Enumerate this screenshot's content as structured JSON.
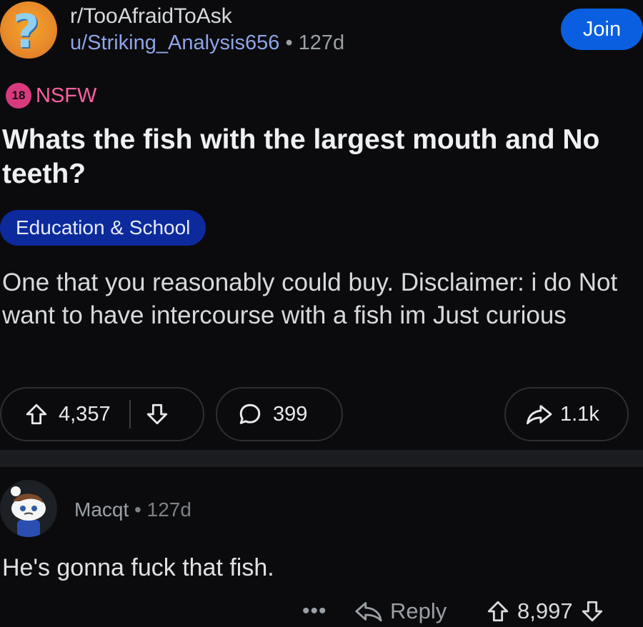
{
  "post": {
    "subreddit": "r/TooAfraidToAsk",
    "author": "u/Striking_Analysis656",
    "separator": "•",
    "age": "127d",
    "join_label": "Join",
    "nsfw_badge": "18",
    "nsfw_label": "NSFW",
    "title": "Whats the fish with the largest mouth and No teeth?",
    "flair": "Education & School",
    "body": "One that you reasonably could buy. Disclaimer: i do Not want to have intercourse with a fish im Just curious",
    "upvotes": "4,357",
    "comments": "399",
    "shares": "1.1k"
  },
  "comment": {
    "author": "Macqt",
    "separator": "•",
    "age": "127d",
    "text": "He's gonna fuck that fish.",
    "more_label": "•••",
    "reply_label": "Reply",
    "score": "8,997"
  },
  "colors": {
    "background": "#0b0b0d",
    "join_button": "#0a5fe0",
    "nsfw": "#ff5fa2",
    "flair_bg": "#0d2a9c",
    "author_link": "#8fa3e8"
  },
  "icons": [
    "question-mark-avatar-icon",
    "upvote-icon",
    "downvote-icon",
    "comment-bubble-icon",
    "share-arrow-icon",
    "reply-arrow-icon",
    "snoo-avatar-icon"
  ]
}
